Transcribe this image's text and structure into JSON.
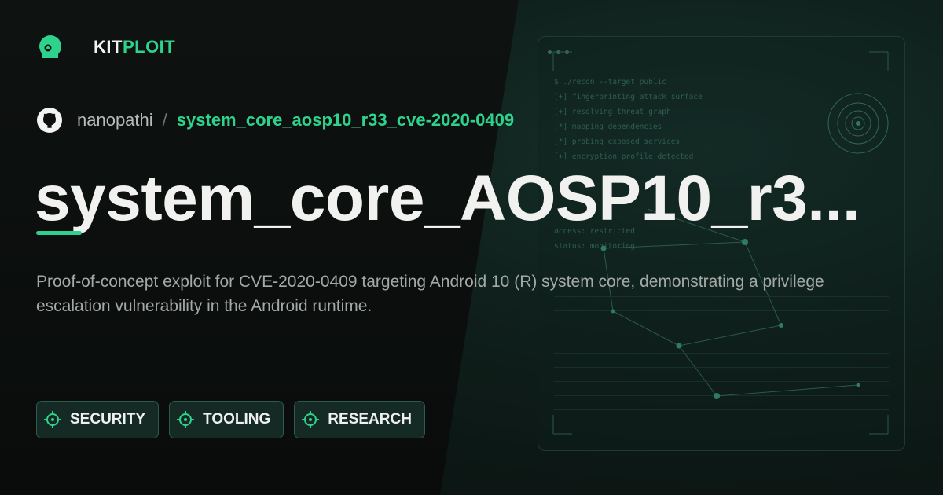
{
  "brand": {
    "name_part1": "KIT",
    "name_part2": "PLOIT",
    "logo_icon": "kitploit-logo-icon"
  },
  "repo": {
    "icon": "github-icon",
    "owner": "nanopathi",
    "separator": "/",
    "name": "system_core_aosp10_r33_cve-2020-0409"
  },
  "title": "system_core_AOSP10_r3...",
  "description": "Proof-of-concept exploit for CVE-2020-0409 targeting Android 10 (R) system core, demonstrating a privilege escalation vulnerability in the Android runtime.",
  "tags": [
    {
      "label": "SECURITY",
      "icon": "crosshair-icon"
    },
    {
      "label": "TOOLING",
      "icon": "crosshair-icon"
    },
    {
      "label": "RESEARCH",
      "icon": "crosshair-icon"
    }
  ],
  "terminal": {
    "lines": [
      "$ ./recon --target public",
      "[+] fingerprinting attack surface",
      "[+] resolving threat graph",
      "[*] mapping dependencies",
      "[*] probing exposed services",
      "[+] encryption profile detected",
      "access: restricted",
      "status: monitoring"
    ]
  },
  "colors": {
    "accent": "#2fd28c",
    "background": "#0b0f0d",
    "panel": "#0f1f1b"
  }
}
